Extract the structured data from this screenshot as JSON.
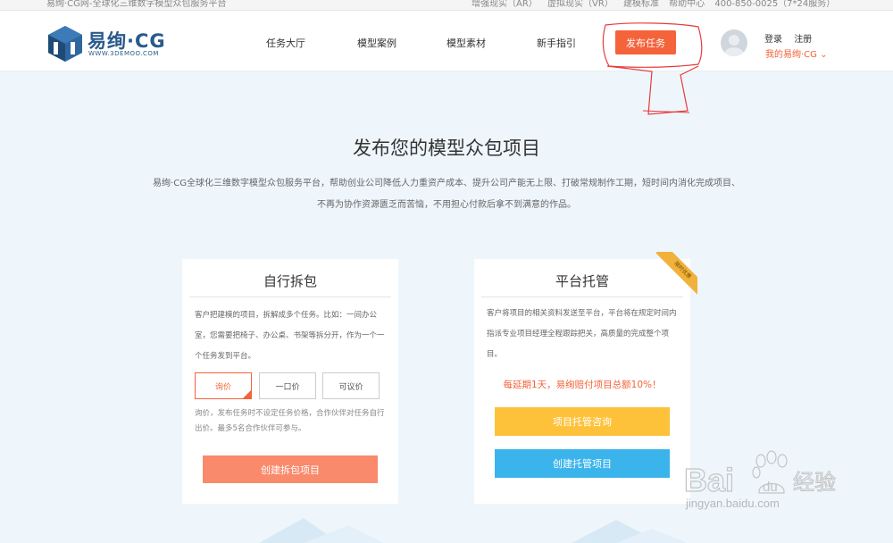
{
  "topbar": {
    "left_text": "易绚·CG网-全球化三维数字模型众包服务平台",
    "right_items": [
      "增强现实（AR）",
      "虚拟现实（VR）",
      "建模标准",
      "帮助中心",
      "400-850-0025（7*24服务）"
    ]
  },
  "header": {
    "logo_text": "易绚·CG",
    "logo_sub": "WWW.3DEMOO.COM",
    "nav": [
      "任务大厅",
      "模型案例",
      "模型素材",
      "新手指引"
    ],
    "publish_label": "发布任务",
    "login_label": "登录",
    "register_label": "注册",
    "my_cg_label": "我的易绚·CG"
  },
  "hero": {
    "title": "发布您的模型众包项目",
    "desc_line1": "易绚·CG全球化三维数字模型众包服务平台，帮助创业公司降低人力重资产成本、提升公司产能无上限、打破常规制作工期，短时间内消化完成项目、",
    "desc_line2": "不再为协作资源匮乏而苦恼，不用担心付款后拿不到满意的作品。"
  },
  "card_split": {
    "title": "自行拆包",
    "desc": "客户把建模的项目，拆解成多个任务。比如：一间办公室，您需要把椅子、办公桌、书架等拆分开，作为一个一个任务发到平台。",
    "price_options": [
      "询价",
      "一口价",
      "可议价"
    ],
    "price_note": "询价，发布任务时不设定任务价格，合作伙伴对任务自行出价。最多5名合作伙伴可参与。",
    "create_label": "创建拆包项目"
  },
  "card_hosted": {
    "title": "平台托管",
    "ribbon": "限时优惠",
    "desc": "客户将项目的相关资料发送至平台，平台将在规定时间内指派专业项目经理全程跟踪把关，高质量的完成整个项目。",
    "penalty": "每延期1天，易绚赔付项目总额10%！",
    "consult_label": "项目托管咨询",
    "create_label": "创建托管项目"
  },
  "watermark": {
    "brand": "Bai du 经验",
    "url": "jingyan.baidu.com"
  },
  "colors": {
    "accent_orange": "#f4633a",
    "button_salmon": "#f98a6c",
    "button_yellow": "#fdc23a",
    "button_blue": "#3bb4ec",
    "background": "#eef6fc"
  }
}
